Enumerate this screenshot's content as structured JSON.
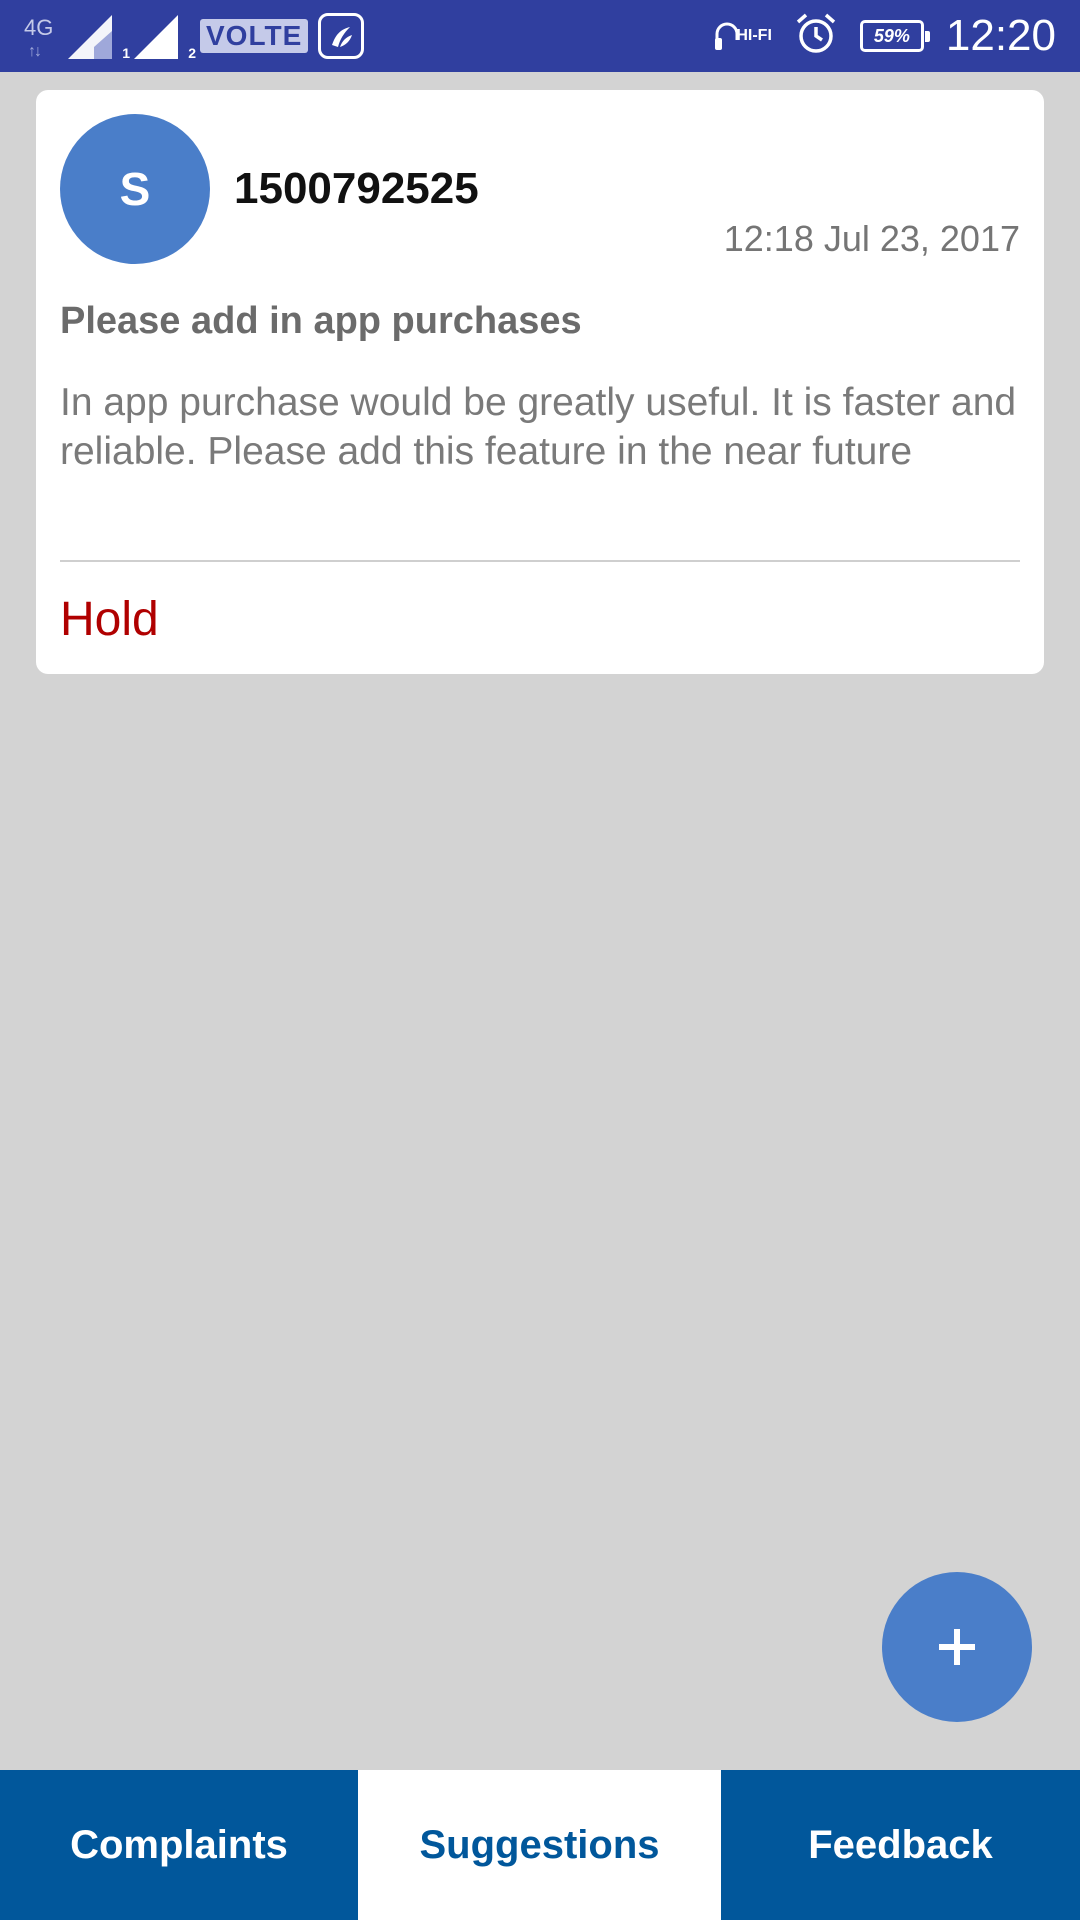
{
  "status_bar": {
    "network_type": "4G",
    "sim1_index": "1",
    "sim2_index": "2",
    "volte_label": "VOLTE",
    "saavn_icon": "saavn-app-icon",
    "hifi_label": "HI-FI",
    "battery_percent": "59%",
    "time": "12:20"
  },
  "card": {
    "avatar_letter": "S",
    "sender": "1500792525",
    "timestamp": "12:18 Jul 23, 2017",
    "subject": "Please add in app purchases",
    "body": "In app purchase would be greatly useful. It is faster and reliable. Please add this feature in the near future",
    "status": "Hold",
    "status_color": "#b00000",
    "avatar_color": "#4a7ec9"
  },
  "fab": {
    "icon": "plus-icon",
    "color": "#4a7ec9"
  },
  "tabs": [
    {
      "label": "Complaints",
      "selected": false
    },
    {
      "label": "Suggestions",
      "selected": true
    },
    {
      "label": "Feedback",
      "selected": false
    }
  ],
  "colors": {
    "status_bar": "#303f9f",
    "tab_dark": "#01579b",
    "background": "#d3d3d3"
  }
}
